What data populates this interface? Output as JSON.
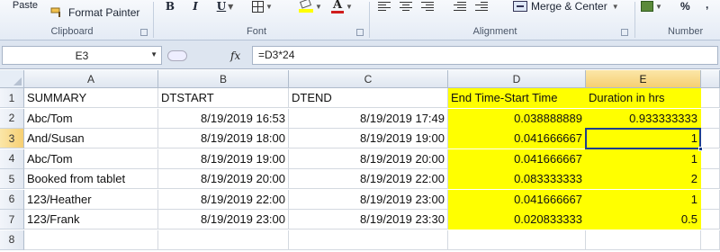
{
  "ribbon": {
    "paste_label": "Paste",
    "format_painter_label": "Format Painter",
    "bold_label": "B",
    "italic_label": "I",
    "underline_label": "U",
    "comma_label": ",",
    "merge_center_label": "Merge & Center",
    "percent_label": "%",
    "groups": {
      "clipboard": "Clipboard",
      "font": "Font",
      "alignment": "Alignment",
      "number": "Number"
    },
    "font_color": "#d01d1d",
    "fill_color": "#ffff00"
  },
  "formula_bar": {
    "name_box": "E3",
    "fx": "fx",
    "formula": "=D3*24"
  },
  "sheet": {
    "columns": [
      "A",
      "B",
      "C",
      "D",
      "E"
    ],
    "selected_column": "E",
    "selected_row": "3",
    "rows": [
      {
        "num": "1",
        "a": "SUMMARY",
        "b": "DTSTART",
        "c": "DTEND",
        "d": "End Time-Start Time",
        "e": "Duration in hrs"
      },
      {
        "num": "2",
        "a": "Abc/Tom",
        "b": "8/19/2019 16:53",
        "c": "8/19/2019 17:49",
        "d": "0.038888889",
        "e": "0.933333333"
      },
      {
        "num": "3",
        "a": "And/Susan",
        "b": "8/19/2019 18:00",
        "c": "8/19/2019 19:00",
        "d": "0.041666667",
        "e": "1"
      },
      {
        "num": "4",
        "a": "Abc/Tom",
        "b": "8/19/2019 19:00",
        "c": "8/19/2019 20:00",
        "d": "0.041666667",
        "e": "1"
      },
      {
        "num": "5",
        "a": "Booked from tablet",
        "b": "8/19/2019 20:00",
        "c": "8/19/2019 22:00",
        "d": "0.083333333",
        "e": "2"
      },
      {
        "num": "6",
        "a": "123/Heather",
        "b": "8/19/2019 22:00",
        "c": "8/19/2019 23:00",
        "d": "0.041666667",
        "e": "1"
      },
      {
        "num": "7",
        "a": "123/Frank",
        "b": "8/19/2019 23:00",
        "c": "8/19/2019 23:30",
        "d": "0.020833333",
        "e": "0.5"
      },
      {
        "num": "8",
        "a": "",
        "b": "",
        "c": "",
        "d": "",
        "e": ""
      }
    ],
    "highlight_color": "#ffff00",
    "active_cell": "E3"
  }
}
